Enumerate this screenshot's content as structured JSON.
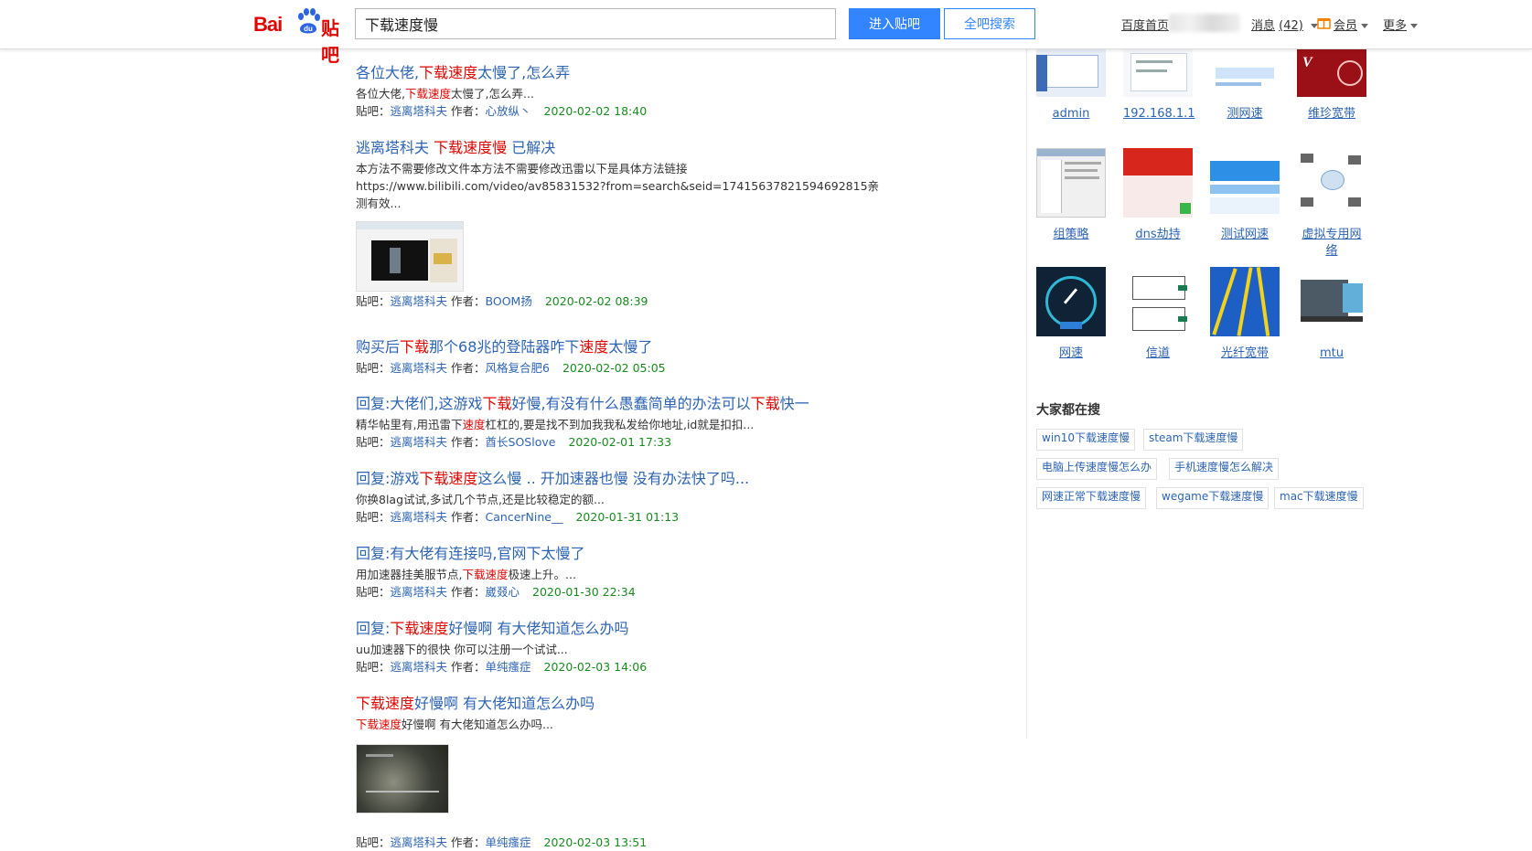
{
  "header": {
    "logo_text": "Baidu贴吧",
    "logo_bai": "Bai",
    "logo_du": "du",
    "logo_tieba": "贴吧",
    "search_value": "下载速度慢",
    "enter_bar_label": "进入贴吧",
    "global_search_label": "全吧搜索",
    "nav": {
      "home": "百度首页",
      "messages": "消息",
      "messages_count": "(42)",
      "vip": "会员",
      "more": "更多"
    }
  },
  "results": [
    {
      "title": [
        {
          "t": "各位大佬,",
          "h": false
        },
        {
          "t": "下载速度",
          "h": true
        },
        {
          "t": "太慢了,怎么弄",
          "h": false
        }
      ],
      "abstract": [
        [
          {
            "t": "各位大佬,",
            "h": false
          },
          {
            "t": "下载速度",
            "h": true
          },
          {
            "t": "太慢了,怎么弄...",
            "h": false
          }
        ]
      ],
      "meta": {
        "bar_label": "贴吧：",
        "bar": "逃离塔科夫",
        "author_label": "作者：",
        "author": "心放纵丶",
        "date": "2020-02-02 18:40"
      }
    },
    {
      "title": [
        {
          "t": "逃离塔科夫 ",
          "h": false
        },
        {
          "t": "下载速度慢",
          "h": true
        },
        {
          "t": " 已解决",
          "h": false
        }
      ],
      "abstract": [
        [
          {
            "t": "本方法不需要修改文件本方法不需要修改迅雷以下是具体方法链接",
            "h": false
          }
        ],
        [
          {
            "t": "https://www.bilibili.com/video/av85831532?from=search&seid=1741563782159469​2815亲",
            "h": false
          }
        ],
        [
          {
            "t": "测有效...",
            "h": false
          }
        ]
      ],
      "meta": {
        "bar_label": "贴吧：",
        "bar": "逃离塔科夫",
        "author_label": "作者：",
        "author": "BOOM扬",
        "date": "2020-02-02 08:39"
      }
    },
    {
      "title": [
        {
          "t": "购买后",
          "h": false
        },
        {
          "t": "下载",
          "h": true
        },
        {
          "t": "那个68兆的登陆器咋下",
          "h": false
        },
        {
          "t": "速度",
          "h": true
        },
        {
          "t": "太慢了",
          "h": false
        }
      ],
      "abstract": [],
      "meta": {
        "bar_label": "贴吧：",
        "bar": "逃离塔科夫",
        "author_label": "作者：",
        "author": "风格复合肥6",
        "date": "2020-02-02 05:05"
      }
    },
    {
      "title": [
        {
          "t": "回复:大佬们,这游戏",
          "h": false
        },
        {
          "t": "下载",
          "h": true
        },
        {
          "t": "好慢,有没有什么愚蠢简单的办法可以",
          "h": false
        },
        {
          "t": "下载",
          "h": true
        },
        {
          "t": "快一",
          "h": false
        }
      ],
      "abstract": [
        [
          {
            "t": "精华帖里有,用迅雷下",
            "h": false
          },
          {
            "t": "速度",
            "h": true
          },
          {
            "t": "杠杠的,要是找不到加我我私发给你地址,id就是扣扣...",
            "h": false
          }
        ]
      ],
      "meta": {
        "bar_label": "贴吧：",
        "bar": "逃离塔科夫",
        "author_label": "作者：",
        "author": "酋长SOSlove",
        "date": "2020-02-01 17:33"
      }
    },
    {
      "title": [
        {
          "t": "回复:游戏",
          "h": false
        },
        {
          "t": "下载速度",
          "h": true
        },
        {
          "t": "这么慢 .. 开加速器也慢 没有办法快了吗...",
          "h": false
        }
      ],
      "abstract": [
        [
          {
            "t": "你换8lag试试,多试几个节点,还是比较稳定的额...",
            "h": false
          }
        ]
      ],
      "meta": {
        "bar_label": "贴吧：",
        "bar": "逃离塔科夫",
        "author_label": "作者：",
        "author": "CancerNine__",
        "date": "2020-01-31 01:13"
      }
    },
    {
      "title": [
        {
          "t": "回复:有大佬有连接吗,官网下太慢了",
          "h": false
        }
      ],
      "abstract": [
        [
          {
            "t": "用加速器挂美服节点,",
            "h": false
          },
          {
            "t": "下载速度",
            "h": true
          },
          {
            "t": "极速上升。...",
            "h": false
          }
        ]
      ],
      "meta": {
        "bar_label": "贴吧：",
        "bar": "逃离塔科夫",
        "author_label": "作者：",
        "author": "崴叕心",
        "date": "2020-01-30 22:34"
      }
    },
    {
      "title": [
        {
          "t": "回复:",
          "h": false
        },
        {
          "t": "下载速度",
          "h": true
        },
        {
          "t": "好慢啊 有大佬知道怎么办吗",
          "h": false
        }
      ],
      "abstract": [
        [
          {
            "t": "uu加速器下的很快 你可以注册一个试试...",
            "h": false
          }
        ]
      ],
      "meta": {
        "bar_label": "贴吧：",
        "bar": "逃离塔科夫",
        "author_label": "作者：",
        "author": "单纯瘙症",
        "date": "2020-02-03 14:06"
      }
    },
    {
      "title": [
        {
          "t": "下载速度",
          "h": true
        },
        {
          "t": "好慢啊 有大佬知道怎么办吗",
          "h": false
        }
      ],
      "abstract": [
        [
          {
            "t": "下载速度",
            "h": true
          },
          {
            "t": "好慢啊 有大佬知道怎么办吗...",
            "h": false
          }
        ]
      ],
      "meta": {
        "bar_label": "贴吧：",
        "bar": "逃离塔科夫",
        "author_label": "作者：",
        "author": "单纯瘙症",
        "date": "2020-02-03 13:51"
      }
    }
  ],
  "sidebar": {
    "image_items": [
      "admin",
      "192.168.1.1",
      "测网速",
      "维珍宽带",
      "组策略",
      "dns劫持",
      "测试网速",
      "虚拟专用网络",
      "网速",
      "信道",
      "光纤宽带",
      "mtu"
    ],
    "hot_title": "大家都在搜",
    "hot_tags": [
      "win10下载速度慢",
      "steam下载速度慢",
      "电脑上传速度慢怎么办",
      "手机速度慢怎么解决",
      "网速正常下载速度慢",
      "wegame下载速度慢",
      "mac下载速度慢"
    ]
  },
  "colors": {
    "link": "#2d64b3",
    "highlight": "#e10602",
    "date": "#178c1d",
    "brand_blue": "#3385ff"
  }
}
